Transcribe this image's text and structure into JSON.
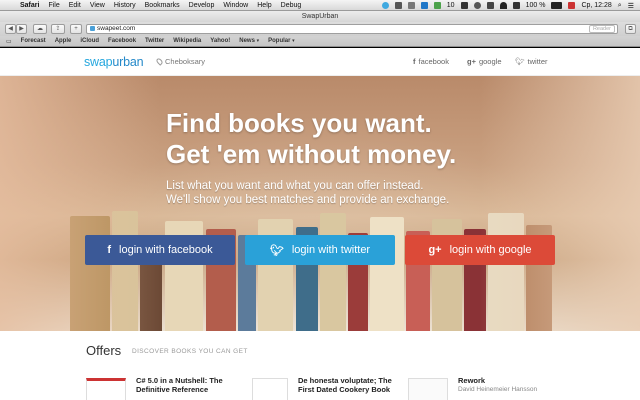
{
  "menubar": {
    "app": "Safari",
    "items": [
      "File",
      "Edit",
      "View",
      "History",
      "Bookmarks",
      "Develop",
      "Window",
      "Help",
      "Debug"
    ],
    "status": {
      "counter": "10",
      "battery": "100 %",
      "clock": "Сp, 12:28"
    }
  },
  "window": {
    "title": "SwapUrban"
  },
  "toolbar": {
    "url": "swapeet.com",
    "reader_label": "Reader"
  },
  "favorites": {
    "items": [
      "Forecast",
      "Apple",
      "iCloud",
      "Facebook",
      "Twitter",
      "Wikipedia",
      "Yahoo!",
      "News",
      "Popular"
    ]
  },
  "site": {
    "logo_part1": "swap",
    "logo_part2": "urban",
    "city": "Cheboksary",
    "social": {
      "facebook": "facebook",
      "google": "google",
      "twitter": "twitter"
    },
    "hero": {
      "title_line1": "Find books you want.",
      "title_line2": "Get 'em without money.",
      "sub_line1": "List what you want and what you can offer instead.",
      "sub_line2": "We'll show you best matches and provide an exchange."
    },
    "buttons": {
      "facebook": "login with facebook",
      "twitter": "login with twitter",
      "google": "login with google"
    },
    "colors": {
      "facebook": "#3b5997",
      "twitter": "#2aa1d8",
      "google": "#dc4a38",
      "brand": "#26a7de"
    },
    "offers": {
      "title": "Offers",
      "subtitle": "DISCOVER BOOKS YOU CAN GET",
      "books": [
        {
          "title": "C# 5.0 in a Nutshell: The Definitive Reference",
          "author": ""
        },
        {
          "title": "De honesta voluptate; The First Dated Cookery Book",
          "author": ""
        },
        {
          "title": "Rework",
          "author": "David Heinemeier Hansson"
        }
      ]
    }
  }
}
